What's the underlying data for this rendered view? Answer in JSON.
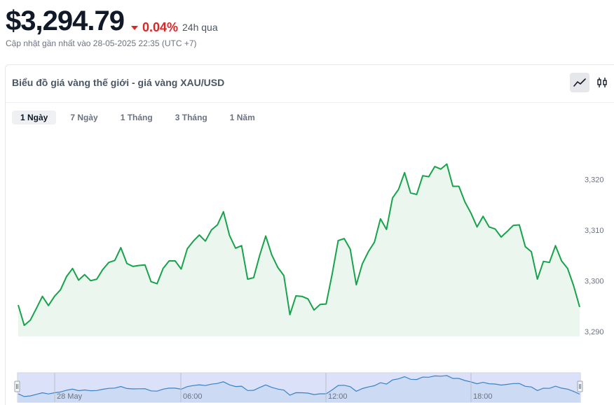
{
  "header": {
    "price": "$3,294.79",
    "change_pct": "0.04%",
    "change_period": "24h qua",
    "change_color": "#dc2626",
    "updated": "Cập nhật gần nhất vào 28-05-2025 22:35 (UTC +7)"
  },
  "card": {
    "title": "Biểu đồ giá vàng thế giới - giá vàng XAU/USD",
    "modes": [
      {
        "icon": "line-chart-icon",
        "active": true
      },
      {
        "icon": "candlestick-icon",
        "active": false
      }
    ],
    "ranges": [
      {
        "label": "1 Ngày",
        "active": true
      },
      {
        "label": "7 Ngày",
        "active": false
      },
      {
        "label": "1 Tháng",
        "active": false
      },
      {
        "label": "3 Tháng",
        "active": false
      },
      {
        "label": "1 Năm",
        "active": false
      }
    ]
  },
  "chart_data": {
    "type": "area",
    "line_color": "#16a34a",
    "fill_color": "#eaf6ee",
    "ylim": [
      3289,
      3325
    ],
    "yticks": [
      "3,290",
      "3,300",
      "3,310",
      "3,320"
    ],
    "ytick_values": [
      3290,
      3300,
      3310,
      3320
    ],
    "navigator": {
      "labels": [
        "28 May",
        "06:00",
        "12:00",
        "18:00"
      ],
      "fill_color": "#d4dcf7",
      "line_color": "#3b82c4"
    },
    "values": [
      3295.2,
      3291.2,
      3292.2,
      3294.5,
      3296.9,
      3295.1,
      3296.9,
      3298.2,
      3300.8,
      3302.4,
      3300.1,
      3301.2,
      3300.0,
      3300.3,
      3302.2,
      3303.6,
      3304.0,
      3306.5,
      3303.4,
      3302.8,
      3303.0,
      3303.1,
      3299.8,
      3299.4,
      3302.4,
      3303.9,
      3303.9,
      3302.3,
      3306.3,
      3307.8,
      3309.0,
      3307.8,
      3310.0,
      3311.0,
      3313.6,
      3308.9,
      3306.4,
      3306.9,
      3300.3,
      3300.6,
      3305.0,
      3308.8,
      3305.1,
      3302.6,
      3301.0,
      3293.3,
      3297.0,
      3296.9,
      3296.4,
      3294.2,
      3295.3,
      3295.4,
      3301.3,
      3307.9,
      3308.3,
      3306.2,
      3299.2,
      3303.3,
      3305.7,
      3307.6,
      3312.2,
      3310.1,
      3316.3,
      3318.0,
      3321.3,
      3317.3,
      3317.0,
      3320.7,
      3320.5,
      3322.5,
      3322.0,
      3323.0,
      3318.6,
      3318.6,
      3315.5,
      3313.3,
      3310.6,
      3312.7,
      3310.6,
      3310.2,
      3308.6,
      3309.7,
      3310.9,
      3311.0,
      3306.7,
      3305.7,
      3300.3,
      3303.8,
      3303.6,
      3306.9,
      3303.9,
      3302.4,
      3299.0,
      3294.8
    ]
  }
}
